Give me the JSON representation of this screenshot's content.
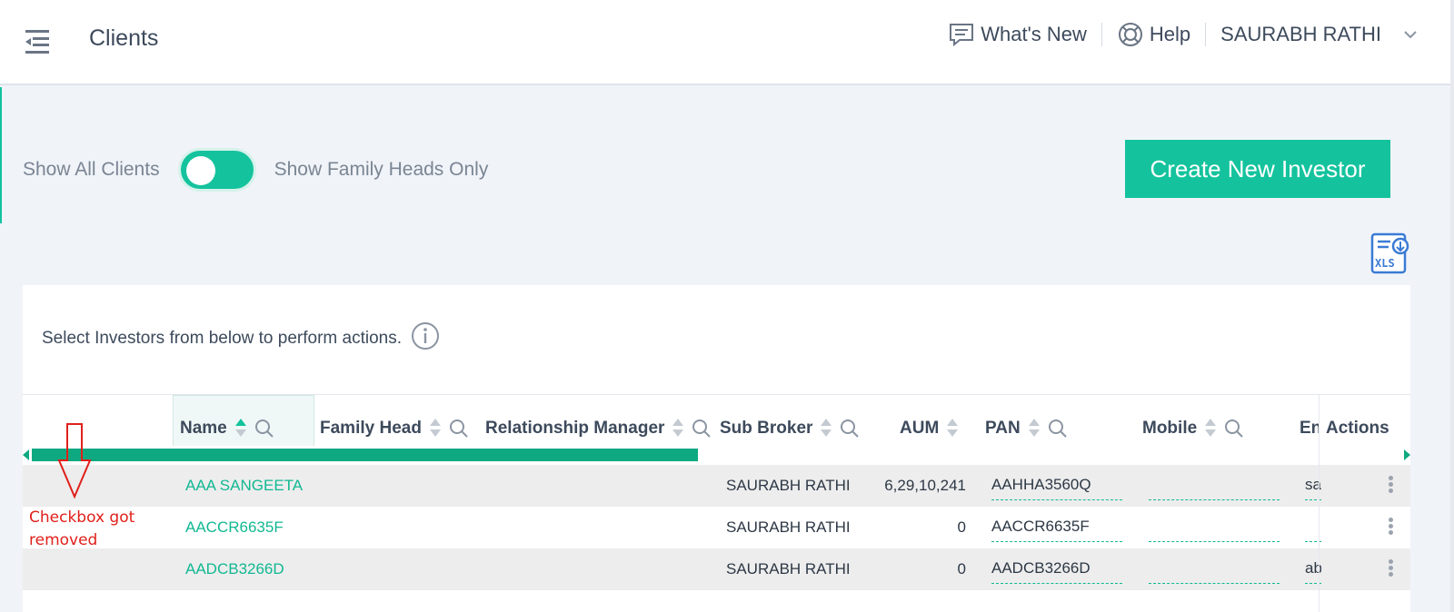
{
  "header": {
    "title": "Clients",
    "whats_new": "What's New",
    "help": "Help",
    "user_name": "SAURABH RATHI"
  },
  "filters": {
    "left_label": "Show All Clients",
    "right_label": "Show Family Heads Only",
    "toggle_on": true
  },
  "actions": {
    "create_label": "Create New Investor",
    "export_icon_text": "XLS"
  },
  "card": {
    "instruction": "Select Investors from below to perform actions."
  },
  "table": {
    "columns": {
      "name": "Name",
      "family_head": "Family Head",
      "relationship_manager": "Relationship Manager",
      "sub_broker": "Sub Broker",
      "aum": "AUM",
      "pan": "PAN",
      "mobile": "Mobile",
      "email": "En",
      "actions": "Actions"
    },
    "rows": [
      {
        "name": "AAA SANGEETA",
        "sub_broker": "SAURABH RATHI",
        "aum": "6,29,10,241",
        "pan": "AAHHA3560Q",
        "mobile": "",
        "email": "sa"
      },
      {
        "name": "AACCR6635F",
        "sub_broker": "SAURABH RATHI",
        "aum": "0",
        "pan": "AACCR6635F",
        "mobile": "",
        "email": ""
      },
      {
        "name": "AADCB3266D",
        "sub_broker": "SAURABH RATHI",
        "aum": "0",
        "pan": "AADCB3266D",
        "mobile": "",
        "email": "ab"
      }
    ],
    "scroll_position": 0.485
  },
  "annotation": {
    "text_line1": "Checkbox got",
    "text_line2": "removed"
  },
  "colors": {
    "accent": "#14c39d",
    "scroll_thumb": "#0fa981",
    "annotation": "#e0201b"
  }
}
